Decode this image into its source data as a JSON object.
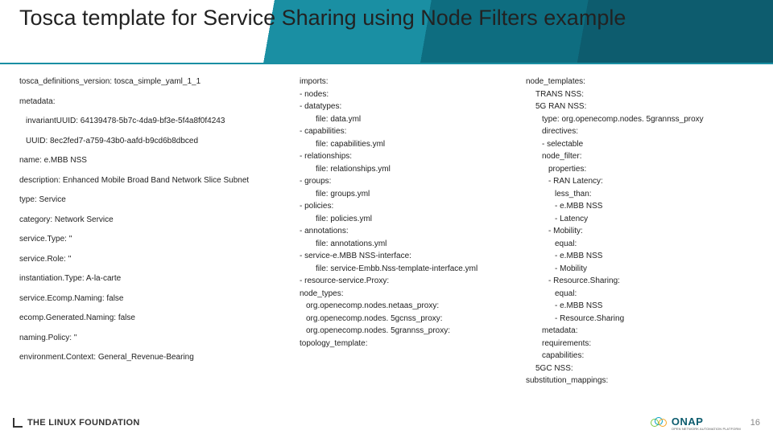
{
  "header": {
    "title": "Tosca template for Service Sharing using Node Filters example"
  },
  "col1": {
    "l0": "tosca_definitions_version: tosca_simple_yaml_1_1",
    "l1": "metadata:",
    "l2": "invariantUUID: 64139478-5b7c-4da9-bf3e-5f4a8f0f4243",
    "l3": "UUID: 8ec2fed7-a759-43b0-aafd-b9cd6b8dbced",
    "l4": "name: e.MBB NSS",
    "l5": "description: Enhanced Mobile Broad Band Network Slice Subnet",
    "l6": "type: Service",
    "l7": "category: Network Service",
    "l8": "service.Type: ''",
    "l9": "service.Role: ''",
    "l10": "instantiation.Type: A-la-carte",
    "l11": "service.Ecomp.Naming: false",
    "l12": "ecomp.Generated.Naming: false",
    "l13": "naming.Policy: ''",
    "l14": "environment.Context: General_Revenue-Bearing"
  },
  "col2": {
    "lines": [
      {
        "c": "",
        "t": "imports:"
      },
      {
        "c": "",
        "t": "- nodes:"
      },
      {
        "c": "",
        "t": "- datatypes:"
      },
      {
        "c": "i2",
        "t": "file: data.yml"
      },
      {
        "c": "",
        "t": "- capabilities:"
      },
      {
        "c": "i2",
        "t": "file: capabilities.yml"
      },
      {
        "c": "",
        "t": "- relationships:"
      },
      {
        "c": "i2",
        "t": "file: relationships.yml"
      },
      {
        "c": "",
        "t": "- groups:"
      },
      {
        "c": "i2",
        "t": "file: groups.yml"
      },
      {
        "c": "",
        "t": "- policies:"
      },
      {
        "c": "i2",
        "t": "file: policies.yml"
      },
      {
        "c": "",
        "t": "- annotations:"
      },
      {
        "c": "i2",
        "t": "file: annotations.yml"
      },
      {
        "c": "",
        "t": "- service-e.MBB NSS-interface:"
      },
      {
        "c": "i2",
        "t": "file: service-Embb.Nss-template-interface.yml"
      },
      {
        "c": "",
        "t": "- resource-service.Proxy:"
      },
      {
        "c": "",
        "t": "node_types:"
      },
      {
        "c": "i1",
        "t": "org.openecomp.nodes.netaas_proxy:"
      },
      {
        "c": "i1",
        "t": "org.openecomp.nodes. 5gcnss_proxy:"
      },
      {
        "c": "i1",
        "t": "org.openecomp.nodes. 5grannss_proxy:"
      },
      {
        "c": "",
        "t": "topology_template:"
      }
    ]
  },
  "col3": {
    "lines": [
      {
        "c": "i1",
        "t": "node_templates:"
      },
      {
        "c": "i2",
        "t": "TRANS NSS:"
      },
      {
        "c": "i2",
        "t": "5G RAN NSS:"
      },
      {
        "c": "i3",
        "t": "type: org.openecomp.nodes. 5grannss_proxy"
      },
      {
        "c": "i3",
        "t": "directives:"
      },
      {
        "c": "i3",
        "t": "- selectable"
      },
      {
        "c": "i3",
        "t": "node_filter:"
      },
      {
        "c": "i4",
        "t": "properties:"
      },
      {
        "c": "i4",
        "t": "- RAN Latency:"
      },
      {
        "c": "i5",
        "t": "less_than:"
      },
      {
        "c": "i5",
        "t": "- e.MBB NSS"
      },
      {
        "c": "i5",
        "t": "- Latency"
      },
      {
        "c": "i4",
        "t": "- Mobility:"
      },
      {
        "c": "i5",
        "t": "equal:"
      },
      {
        "c": "i5",
        "t": "- e.MBB NSS"
      },
      {
        "c": "i5",
        "t": "- Mobility"
      },
      {
        "c": "i4",
        "t": "- Resource.Sharing:"
      },
      {
        "c": "i5",
        "t": "equal:"
      },
      {
        "c": "i5",
        "t": "- e.MBB NSS"
      },
      {
        "c": "i5",
        "t": "- Resource.Sharing"
      },
      {
        "c": "i3",
        "t": "metadata:"
      },
      {
        "c": "i3",
        "t": "requirements:"
      },
      {
        "c": "i3",
        "t": "capabilities:"
      },
      {
        "c": "i2",
        "t": "5GC NSS:"
      },
      {
        "c": "i1",
        "t": "substitution_mappings:"
      }
    ]
  },
  "footer": {
    "linux": "THE LINUX FOUNDATION",
    "onap": "ONAP",
    "onap_sub": "OPEN NETWORK AUTOMATION PLATFORM",
    "page": "16"
  }
}
